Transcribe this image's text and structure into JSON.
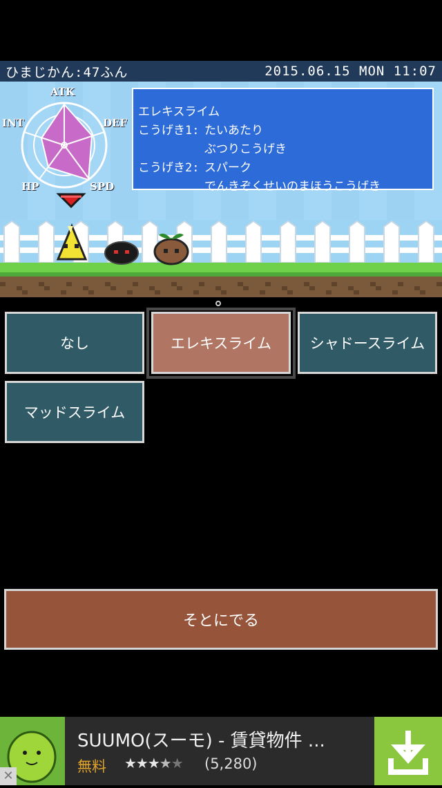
{
  "status_bar": {
    "left_text": "ひまじかん:47ふん",
    "right_text": "2015.06.15 MON 11:07"
  },
  "radar": {
    "labels": {
      "atk": "ATK",
      "def": "DEF",
      "spd": "SPD",
      "hp": "HP",
      "int": "INT"
    },
    "fill_color": "#c86bc8"
  },
  "info": {
    "name": "エレキスライム",
    "attack1_label": "こうげき1:",
    "attack1_line1": "たいあたり",
    "attack1_line2": "ぶつりこうげき",
    "attack2_label": "こうげき2:",
    "attack2_line1": "スパーク",
    "attack2_line2": "でんきぞくせいのまほうこうげき"
  },
  "slots": [
    {
      "label": "なし",
      "selected": false
    },
    {
      "label": "エレキスライム",
      "selected": true
    },
    {
      "label": "シャドースライム",
      "selected": false
    },
    {
      "label": "マッドスライム",
      "selected": false
    }
  ],
  "exit_label": "そとにでる",
  "ad": {
    "title": "SUUMO(スーモ) - 賃貸物件 ...",
    "price": "無料",
    "rating": 3.5,
    "rating_count": "(5,280)",
    "close_glyph": "✕",
    "colors": {
      "download_bg": "#8bc63f",
      "price": "#e3a32a"
    }
  }
}
